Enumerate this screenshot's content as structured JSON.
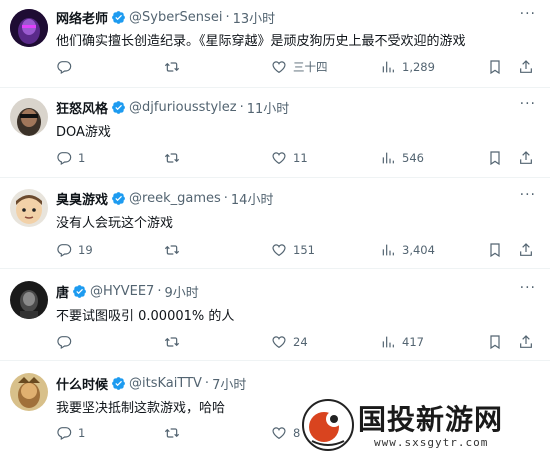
{
  "tweets": [
    {
      "name": "网络老师",
      "handle": "@SyberSensei",
      "time": "13小时",
      "text": "他们确实擅长创造纪录。《星际穿越》是顽皮狗历史上最不受欢迎的游戏",
      "replies": "",
      "retweets": "",
      "likes": "三十四",
      "views": "1,289",
      "verified": true,
      "avatar_color": "#3b1a5e"
    },
    {
      "name": "狂怒风格",
      "handle": "@djfuriousstylez",
      "time": "11小时",
      "text": "DOA游戏",
      "replies": "1",
      "retweets": "",
      "likes": "11",
      "views": "546",
      "verified": true,
      "avatar_color": "#3a3a3a"
    },
    {
      "name": "臭臭游戏",
      "handle": "@reek_games",
      "time": "14小时",
      "text": "没有人会玩这个游戏",
      "replies": "19",
      "retweets": "",
      "likes": "151",
      "views": "3,404",
      "verified": true,
      "avatar_color": "#f1d6b0"
    },
    {
      "name": "唐",
      "handle": "@HYVEE7",
      "time": "9小时",
      "text": "不要试图吸引 0.00001% 的人",
      "replies": "",
      "retweets": "",
      "likes": "24",
      "views": "417",
      "verified": true,
      "avatar_color": "#2a2a2a"
    },
    {
      "name": "什么时候",
      "handle": "@itsKaiTTV",
      "time": "7小时",
      "text": "我要坚决抵制这款游戏，哈哈",
      "replies": "1",
      "retweets": "",
      "likes": "8",
      "views": "",
      "verified": true,
      "avatar_color": "#c9a060"
    }
  ],
  "separator": "·",
  "more_label": "···",
  "watermark": {
    "text": "国投新游网",
    "url": "www.sxsgytr.com"
  },
  "colors": {
    "verified": "#1d9bf0",
    "muted": "#536471"
  }
}
